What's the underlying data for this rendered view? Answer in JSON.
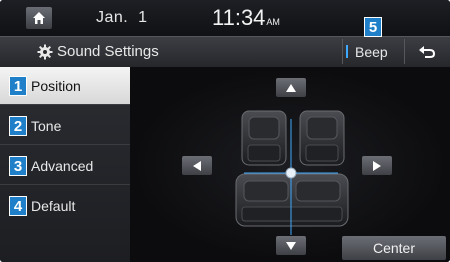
{
  "status": {
    "date": "Jan.  1",
    "time": "11:34",
    "ampm": "AM"
  },
  "title": {
    "text": "Sound Settings",
    "beep_label": "Beep"
  },
  "sidebar": {
    "items": [
      {
        "label": "Position",
        "active": true
      },
      {
        "label": "Tone",
        "active": false
      },
      {
        "label": "Advanced",
        "active": false
      },
      {
        "label": "Default",
        "active": false
      }
    ]
  },
  "callouts": [
    "1",
    "2",
    "3",
    "4",
    "5"
  ],
  "main": {
    "center_label": "Center"
  },
  "icons": {
    "home": "home-icon",
    "settings": "gear-icon",
    "back": "back-arrow-icon",
    "up": "arrow-up-icon",
    "down": "arrow-down-icon",
    "left": "arrow-left-icon",
    "right": "arrow-right-icon"
  },
  "colors": {
    "accent": "#3fa9ff",
    "callout": "#1f7fc8"
  }
}
